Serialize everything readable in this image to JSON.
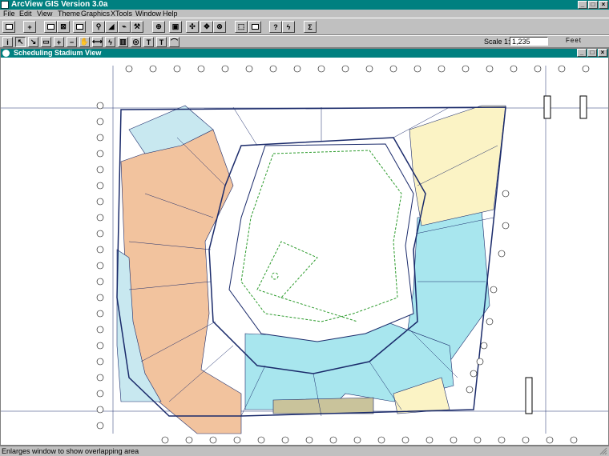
{
  "app": {
    "title": "ArcView GIS Version 3.0a"
  },
  "window_controls": [
    "_",
    "□",
    "×"
  ],
  "menu": [
    "File",
    "Edit",
    "View",
    "Theme",
    "Graphics",
    "XTools",
    "Window",
    "Help"
  ],
  "toolbar": {
    "buttons": [
      "save-view",
      "add-theme",
      "theme-properties",
      "edit-legend",
      "open-table",
      "find",
      "locate",
      "query-builder",
      "select-features",
      "zoom-full",
      "zoom-active",
      "zoom-selected",
      "zoom-in",
      "zoom-out",
      "zoom-previous",
      "clear-selection",
      "help",
      "statistics"
    ],
    "tools": [
      "info",
      "pointer",
      "vertex-edit",
      "select-feature",
      "zoom-in-tool",
      "zoom-out-tool",
      "pan",
      "measure",
      "hot-link",
      "area-of-interest",
      "identify",
      "label",
      "text",
      "draw"
    ],
    "scale_label": "Scale 1:",
    "scale_value": "1,235",
    "units_label": "Feet"
  },
  "view_window": {
    "title": "Scheduling Stadium View"
  },
  "status_bar": {
    "text": "Enlarges window to show overlapping area"
  },
  "map": {
    "description_colors": {
      "section_orange": "#f2c39e",
      "section_cyan": "#a8e6ee",
      "section_yellow": "#fbf3c5",
      "section_lightblue": "#c8e8f0",
      "field_line_green": "#2a9a2a",
      "plan_line_navy": "#1a2a6a"
    }
  }
}
